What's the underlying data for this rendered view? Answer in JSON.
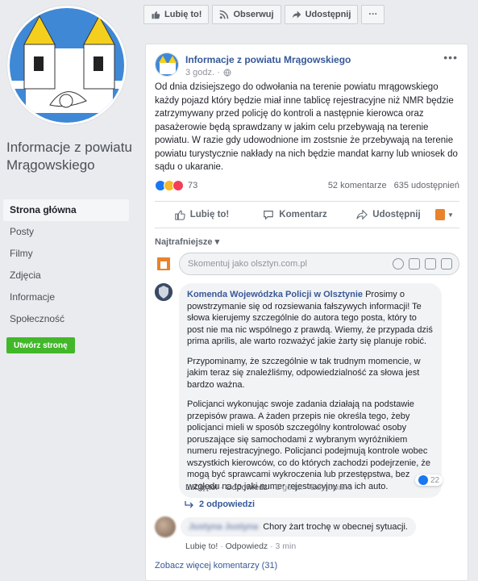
{
  "topbar": {
    "like": "Lubię to!",
    "follow": "Obserwuj",
    "share": "Udostępnij",
    "more": "···"
  },
  "page": {
    "name": "Informacje z powiatu Mrągowskiego"
  },
  "nav": {
    "items": [
      "Strona główna",
      "Posty",
      "Filmy",
      "Zdjęcia",
      "Informacje",
      "Społeczność"
    ],
    "create": "Utwórz stronę"
  },
  "post": {
    "author": "Informacje z powiatu Mrągowskiego",
    "time": "3 godz. ·",
    "text": "Od dnia dzisiejszego do odwołania na terenie powiatu mrągowskiego każdy pojazd który będzie miał inne tablicę rejestracyjne niż NMR będzie zatrzymywany przed policję do kontroli a następnie kierowca oraz pasażerowie będą sprawdzany w jakim celu przebywają na terenie powiatu. W razie gdy udowodnione im zostsnie że przebywają na terenie powiatu turystycznie nakłady na nich będzie mandat karny lub wniosek do sądu o ukaranie.",
    "reactions": "73",
    "comments": "52 komentarze",
    "shares": "635 udostępnień",
    "actions": {
      "like": "Lubię to!",
      "comment": "Komentarz",
      "share": "Udostępnij"
    }
  },
  "comments_section": {
    "sort": "Najtrafniejsze ▾",
    "placeholder": "Skomentuj jako olsztyn.com.pl",
    "c1": {
      "author": "Komenda Wojewódzka Policji w Olsztynie",
      "p1": " Prosimy o powstrzymanie się od rozsiewania fałszywych informacji! Te słowa kierujemy szczególnie do autora tego posta, który to post nie ma nic wspólnego z prawdą. Wiemy, że przypada dziś prima aprilis, ale warto rozważyć jakie żarty się planuje robić.",
      "p2": "Przypominamy, że szczególnie w tak trudnym momencie, w jakim teraz się znaleźliśmy, odpowiedzialność za słowa jest bardzo ważna.",
      "p3": "Policjanci wykonując swoje zadania działają na podstawie przepisów prawa. A żaden przepis nie określa tego, żeby policjanci mieli w sposób szczególny kontrolować osoby poruszające się samochodami z wybranym wyróżnikiem numeru rejestracyjnego. Policjanci podejmują kontrole wobec wszystkich kierowców, co do których zachodzi podejrzenie, że mogą być sprawcami wykroczenia lub przestępstwa, bez względu na to jaki numer rejestracyjny ma ich auto.",
      "likes": "22",
      "like": "Lubię to!",
      "reply": "Odpowiedz",
      "time": "1 godz.",
      "edited": "Edytowano"
    },
    "replies": "2 odpowiedzi",
    "c2": {
      "author": "Justyna Justyna",
      "text": "Chory żart trochę w obecnej sytuacji.",
      "like": "Lubię to!",
      "reply": "Odpowiedz",
      "time": "3 min"
    },
    "more": "Zobacz więcej komentarzy (31)"
  },
  "colors": {
    "link": "#365899",
    "background": "#e9ebee",
    "green": "#42b72a"
  }
}
